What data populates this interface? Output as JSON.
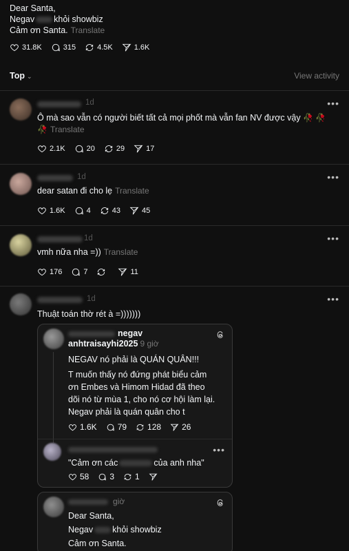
{
  "post": {
    "lines": [
      "Dear Santa,",
      "khỏi showbiz",
      "Cảm ơn Santa."
    ],
    "line2_prefix": "Negav",
    "translate": "Translate",
    "likes": "31.8K",
    "comments": "315",
    "reposts": "4.5K",
    "shares": "1.6K"
  },
  "sort": {
    "label": "Top",
    "view_activity": "View activity"
  },
  "comments": [
    {
      "text": "Ô mà sao vẫn có người biết tất cả mọi phốt mà vẫn fan NV được vậy",
      "roses": "🥀 🥀",
      "rose_line2": "🥀",
      "translate": "Translate",
      "time": "1d",
      "likes": "2.1K",
      "replies": "20",
      "reposts": "29",
      "shares": "17"
    },
    {
      "text": "dear satan đi cho lẹ",
      "translate": "Translate",
      "time": "1d",
      "likes": "1.6K",
      "replies": "4",
      "reposts": "43",
      "shares": "45"
    },
    {
      "text": "vmh nữa nha =))",
      "translate": "Translate",
      "time": "1d",
      "likes": "176",
      "replies": "7",
      "reposts": "",
      "shares": "11"
    },
    {
      "text": "Thuật toán thờ rét à =)))))))",
      "time": "1d"
    }
  ],
  "quote": {
    "name_suffix": "negav",
    "name_line2": "anhtraisayhi2025",
    "time": "9 giờ",
    "lines": [
      "NEGAV nó phải là QUÁN QUÂN!!!",
      "T muốn thấy nó đứng phát biểu cảm",
      "ơn Embes và Himom Hidad đã theo",
      "dõi nó từ mùa 1, cho nó cơ hội làm lại.",
      "Negav phải là quán quân cho t"
    ],
    "likes": "1.6K",
    "replies": "79",
    "reposts": "128",
    "shares": "26",
    "reply_text_a": "\"Cảm ơn các",
    "reply_text_b": "của anh nha\"",
    "reply_likes": "58",
    "reply_replies": "3",
    "reply_reposts": "1"
  },
  "quote2": {
    "time": "giờ",
    "lines": [
      "Dear Santa,",
      "khỏi showbiz",
      "Cảm ơn Santa."
    ],
    "line2_prefix": "Negav"
  },
  "colors": {
    "background": "#101010",
    "text": "#f3f5f7",
    "muted": "#777777",
    "divider": "#2a2a2a"
  }
}
